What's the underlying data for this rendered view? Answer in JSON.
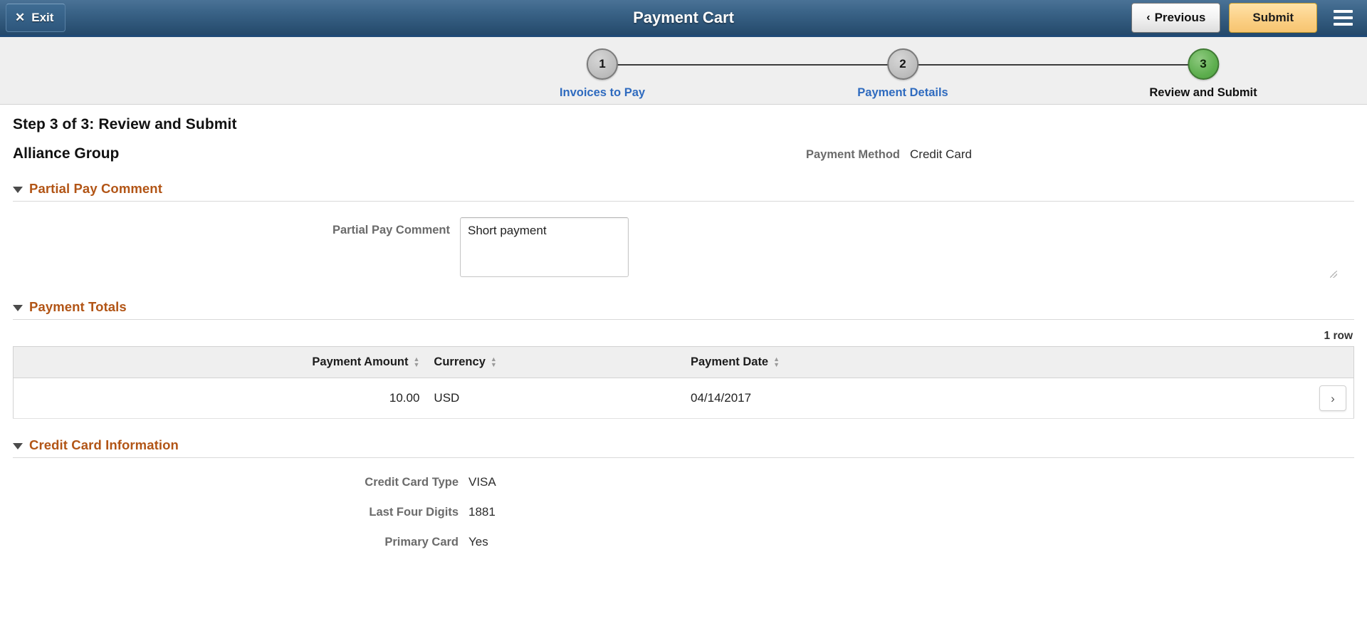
{
  "header": {
    "exit_label": "Exit",
    "exit_icon": "close-x-icon",
    "title": "Payment Cart",
    "previous_label": "Previous",
    "previous_icon": "chevron-left-icon",
    "submit_label": "Submit",
    "menu_icon": "hamburger-menu-icon",
    "bar_color": "#2d567c",
    "submit_color": "#fbd086"
  },
  "stepper": {
    "steps": [
      {
        "number": "1",
        "label": "Invoices to Pay",
        "state": "done"
      },
      {
        "number": "2",
        "label": "Payment Details",
        "state": "done"
      },
      {
        "number": "3",
        "label": "Review and Submit",
        "state": "current"
      }
    ],
    "current_color": "#5dae4e",
    "inactive_color": "#bdbdbd",
    "link_color": "#2f6bbf"
  },
  "page": {
    "title": "Step 3 of 3: Review and Submit",
    "subtitle": "Alliance Group",
    "payment_method_label": "Payment Method",
    "payment_method_value": "Credit Card"
  },
  "partial_pay": {
    "section_title": "Partial Pay Comment",
    "caret_icon": "caret-down-icon",
    "field_label": "Partial Pay Comment",
    "field_value": "Short payment",
    "field_placeholder": ""
  },
  "payment_totals": {
    "section_title": "Payment Totals",
    "caret_icon": "caret-down-icon",
    "row_count": "1 row",
    "columns": [
      {
        "label": "Payment Amount",
        "sort_icon": "sort-updown-icon"
      },
      {
        "label": "Currency",
        "sort_icon": "sort-updown-icon"
      },
      {
        "label": "Payment Date",
        "sort_icon": "sort-updown-icon"
      }
    ],
    "rows": [
      {
        "amount": "10.00",
        "currency": "USD",
        "date": "04/14/2017",
        "action_icon": "chevron-right-icon"
      }
    ]
  },
  "credit_card": {
    "section_title": "Credit Card Information",
    "caret_icon": "caret-down-icon",
    "fields": [
      {
        "label": "Credit Card Type",
        "value": "VISA"
      },
      {
        "label": "Last Four Digits",
        "value": "1881"
      },
      {
        "label": "Primary Card",
        "value": "Yes"
      }
    ]
  }
}
